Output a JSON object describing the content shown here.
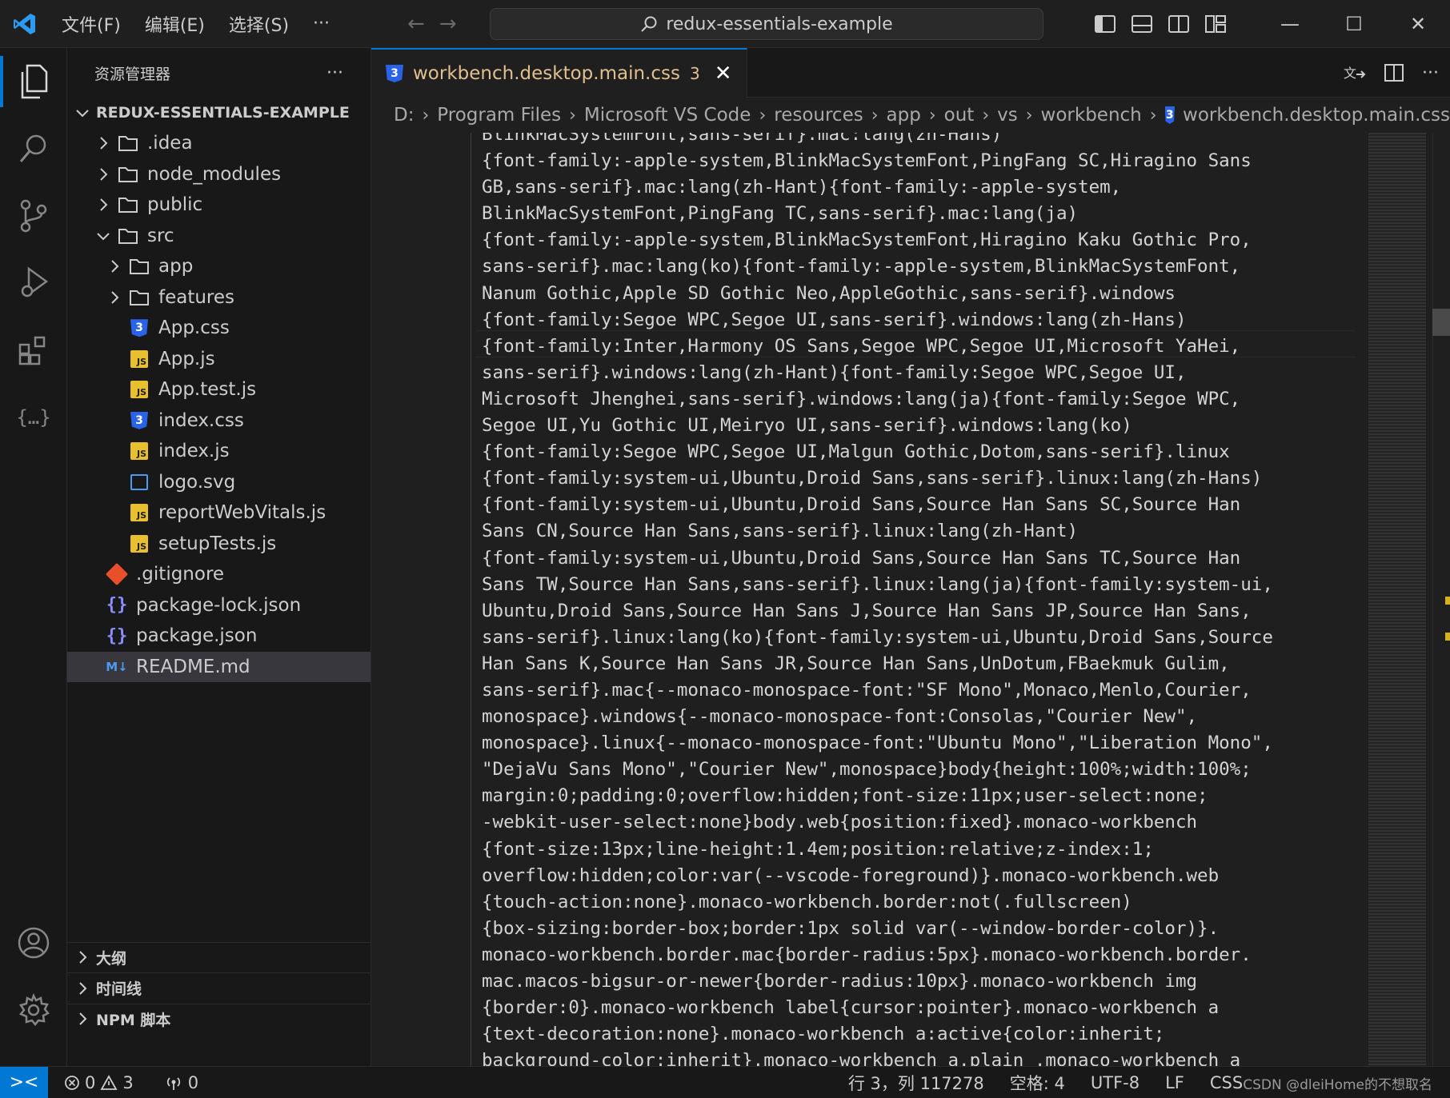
{
  "titlebar": {
    "menu": [
      "文件(F)",
      "编辑(E)",
      "选择(S)",
      "···"
    ],
    "search_text": "redux-essentials-example",
    "nav_back": "←",
    "nav_forward": "→",
    "window_buttons": {
      "minimize": "—",
      "maximize": "☐",
      "close": "✕"
    }
  },
  "sidebar": {
    "title": "资源管理器",
    "more": "···",
    "root": "REDUX-ESSENTIALS-EXAMPLE",
    "tree": [
      {
        "label": ".idea",
        "type": "folder",
        "depth": 1,
        "expanded": false
      },
      {
        "label": "node_modules",
        "type": "folder",
        "depth": 1,
        "expanded": false
      },
      {
        "label": "public",
        "type": "folder",
        "depth": 1,
        "expanded": false
      },
      {
        "label": "src",
        "type": "folder",
        "depth": 1,
        "expanded": true
      },
      {
        "label": "app",
        "type": "folder",
        "depth": 2,
        "expanded": false
      },
      {
        "label": "features",
        "type": "folder",
        "depth": 2,
        "expanded": false
      },
      {
        "label": "App.css",
        "type": "css",
        "depth": 2
      },
      {
        "label": "App.js",
        "type": "js",
        "depth": 2
      },
      {
        "label": "App.test.js",
        "type": "js",
        "depth": 2
      },
      {
        "label": "index.css",
        "type": "css",
        "depth": 2
      },
      {
        "label": "index.js",
        "type": "js",
        "depth": 2
      },
      {
        "label": "logo.svg",
        "type": "svg",
        "depth": 2
      },
      {
        "label": "reportWebVitals.js",
        "type": "js",
        "depth": 2
      },
      {
        "label": "setupTests.js",
        "type": "js",
        "depth": 2
      },
      {
        "label": ".gitignore",
        "type": "git",
        "depth": 1
      },
      {
        "label": "package-lock.json",
        "type": "json",
        "depth": 1
      },
      {
        "label": "package.json",
        "type": "json",
        "depth": 1
      },
      {
        "label": "README.md",
        "type": "md",
        "depth": 1,
        "selected": true
      }
    ],
    "panels": [
      "大纲",
      "时间线",
      "NPM 脚本"
    ]
  },
  "editor": {
    "tab": {
      "label": "workbench.desktop.main.css",
      "problems": "3",
      "close": "✕"
    },
    "breadcrumbs": [
      "D:",
      "Program Files",
      "Microsoft VS Code",
      "resources",
      "app",
      "out",
      "vs",
      "workbench",
      "workbench.desktop.main.css"
    ],
    "code_lines": [
      "BlinkMacSystemFont,sans-serif}.mac:lang(zh-Hans)",
      "{font-family:-apple-system,BlinkMacSystemFont,PingFang SC,Hiragino Sans",
      "GB,sans-serif}.mac:lang(zh-Hant){font-family:-apple-system,",
      "BlinkMacSystemFont,PingFang TC,sans-serif}.mac:lang(ja)",
      "{font-family:-apple-system,BlinkMacSystemFont,Hiragino Kaku Gothic Pro,",
      "sans-serif}.mac:lang(ko){font-family:-apple-system,BlinkMacSystemFont,",
      "Nanum Gothic,Apple SD Gothic Neo,AppleGothic,sans-serif}.windows",
      "{font-family:Segoe WPC,Segoe UI,sans-serif}.windows:lang(zh-Hans)",
      "{font-family:Inter,Harmony OS Sans,Segoe WPC,Segoe UI,Microsoft YaHei,",
      "sans-serif}.windows:lang(zh-Hant){font-family:Segoe WPC,Segoe UI,",
      "Microsoft Jhenghei,sans-serif}.windows:lang(ja){font-family:Segoe WPC,",
      "Segoe UI,Yu Gothic UI,Meiryo UI,sans-serif}.windows:lang(ko)",
      "{font-family:Segoe WPC,Segoe UI,Malgun Gothic,Dotom,sans-serif}.linux",
      "{font-family:system-ui,Ubuntu,Droid Sans,sans-serif}.linux:lang(zh-Hans)",
      "{font-family:system-ui,Ubuntu,Droid Sans,Source Han Sans SC,Source Han",
      "Sans CN,Source Han Sans,sans-serif}.linux:lang(zh-Hant)",
      "{font-family:system-ui,Ubuntu,Droid Sans,Source Han Sans TC,Source Han",
      "Sans TW,Source Han Sans,sans-serif}.linux:lang(ja){font-family:system-ui,",
      "Ubuntu,Droid Sans,Source Han Sans J,Source Han Sans JP,Source Han Sans,",
      "sans-serif}.linux:lang(ko){font-family:system-ui,Ubuntu,Droid Sans,Source",
      "Han Sans K,Source Han Sans JR,Source Han Sans,UnDotum,FBaekmuk Gulim,",
      "sans-serif}.mac{--monaco-monospace-font:\"SF Mono\",Monaco,Menlo,Courier,",
      "monospace}.windows{--monaco-monospace-font:Consolas,\"Courier New\",",
      "monospace}.linux{--monaco-monospace-font:\"Ubuntu Mono\",\"Liberation Mono\",",
      "\"DejaVu Sans Mono\",\"Courier New\",monospace}body{height:100%;width:100%;",
      "margin:0;padding:0;overflow:hidden;font-size:11px;user-select:none;",
      "-webkit-user-select:none}body.web{position:fixed}.monaco-workbench",
      "{font-size:13px;line-height:1.4em;position:relative;z-index:1;",
      "overflow:hidden;color:var(--vscode-foreground)}.monaco-workbench.web",
      "{touch-action:none}.monaco-workbench.border:not(.fullscreen)",
      "{box-sizing:border-box;border:1px solid var(--window-border-color)}.",
      "monaco-workbench.border.mac{border-radius:5px}.monaco-workbench.border.",
      "mac.macos-bigsur-or-newer{border-radius:10px}.monaco-workbench img",
      "{border:0}.monaco-workbench label{cursor:pointer}.monaco-workbench a",
      "{text-decoration:none}.monaco-workbench a:active{color:inherit;",
      "background-color:inherit}.monaco-workbench a.plain .monaco-workbench a"
    ]
  },
  "statusbar": {
    "remote": "><",
    "errors": "0",
    "warnings": "3",
    "ports": "0",
    "position": "行 3，列 117278",
    "indent": "空格: 4",
    "encoding": "UTF-8",
    "eol": "LF",
    "language": "CSS",
    "watermark": "CSDN @dleiHome的不想取名"
  },
  "colors": {
    "accent": "#0078d4",
    "tab_modified": "#e2c08d",
    "background": "#1f1f1f",
    "sidebar": "#181818"
  }
}
